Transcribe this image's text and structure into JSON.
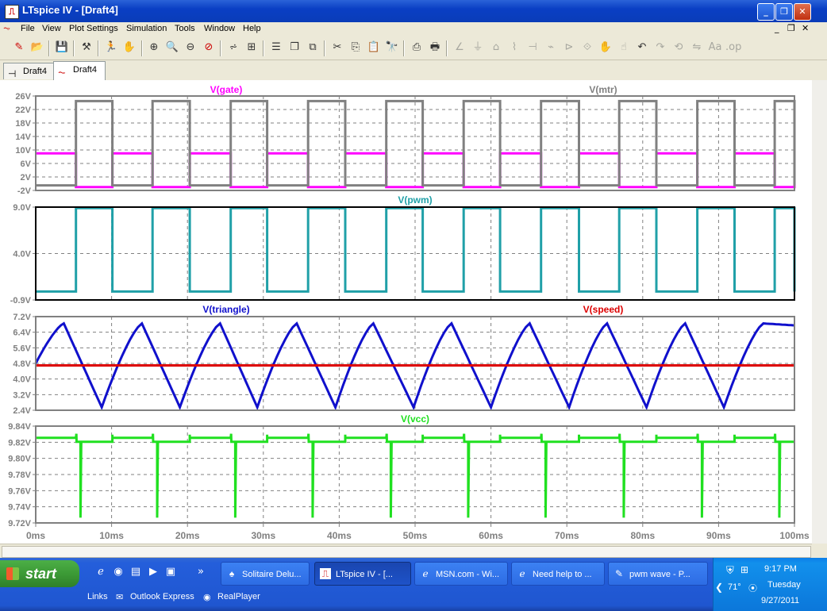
{
  "window": {
    "title": "LTspice IV - [Draft4]"
  },
  "menu": [
    "File",
    "View",
    "Plot Settings",
    "Simulation",
    "Tools",
    "Window",
    "Help"
  ],
  "tabs": [
    {
      "label": "Draft4",
      "icon": "schematic-icon"
    },
    {
      "label": "Draft4",
      "icon": "waveform-icon"
    }
  ],
  "chart_data": [
    {
      "type": "line",
      "series": [
        {
          "name": "V(gate)",
          "color": "#FF00FF",
          "high": 9,
          "low": -1,
          "low_intervals_ms": [
            [
              5.3,
              10.1
            ],
            [
              15.4,
              20.3
            ],
            [
              25.7,
              30.5
            ],
            [
              35.9,
              40.8
            ],
            [
              46.2,
              51.0
            ],
            [
              56.4,
              61.2
            ],
            [
              66.6,
              71.6
            ],
            [
              76.9,
              81.8
            ],
            [
              87.2,
              92.1
            ],
            [
              97.4,
              100
            ]
          ]
        },
        {
          "name": "V(mtr)",
          "color": "#808080",
          "high": 24.5,
          "low": -0.5,
          "high_intervals_ms": [
            [
              5.3,
              10.1
            ],
            [
              15.4,
              20.3
            ],
            [
              25.7,
              30.5
            ],
            [
              35.9,
              40.8
            ],
            [
              46.2,
              51.0
            ],
            [
              56.4,
              61.2
            ],
            [
              66.6,
              71.6
            ],
            [
              76.9,
              81.8
            ],
            [
              87.2,
              92.1
            ],
            [
              97.4,
              100
            ]
          ]
        }
      ],
      "yticks": [
        "26V",
        "22V",
        "18V",
        "14V",
        "10V",
        "6V",
        "2V",
        "-2V"
      ],
      "ylim": [
        -2,
        26
      ],
      "xlim": [
        0,
        100
      ]
    },
    {
      "type": "line",
      "series": [
        {
          "name": "V(pwm)",
          "color": "#20A0A8",
          "high": 8.9,
          "low": 0,
          "high_intervals_ms": [
            [
              5.3,
              10.1
            ],
            [
              15.4,
              20.3
            ],
            [
              25.7,
              30.5
            ],
            [
              35.9,
              40.8
            ],
            [
              46.2,
              51.0
            ],
            [
              56.4,
              61.2
            ],
            [
              66.6,
              71.6
            ],
            [
              76.9,
              81.8
            ],
            [
              87.2,
              92.1
            ],
            [
              97.4,
              100
            ]
          ]
        }
      ],
      "yticks": [
        "9.0V",
        "4.0V",
        "-0.9V"
      ],
      "ylim": [
        -0.9,
        9.0
      ],
      "xlim": [
        0,
        100
      ]
    },
    {
      "type": "line",
      "series": [
        {
          "name": "V(triangle)",
          "color": "#1010CC",
          "start": 4.8,
          "peaks_ms": [
            3.7,
            14.0,
            24.3,
            34.4,
            44.5,
            54.8,
            65.1,
            75.3,
            85.6,
            95.9
          ],
          "peak_value": 6.85,
          "troughs_ms": [
            8.7,
            19.0,
            29.2,
            39.5,
            49.8,
            60.0,
            70.3,
            80.5,
            90.7
          ],
          "trough_value": 2.55,
          "end": 6.75
        },
        {
          "name": "V(speed)",
          "color": "#DD0000",
          "value": 4.7
        }
      ],
      "yticks": [
        "7.2V",
        "6.4V",
        "5.6V",
        "4.8V",
        "4.0V",
        "3.2V",
        "2.4V"
      ],
      "ylim": [
        2.4,
        7.2
      ],
      "xlim": [
        0,
        100
      ]
    },
    {
      "type": "line",
      "series": [
        {
          "name": "V(vcc)",
          "color": "#20E020",
          "high": 9.8255,
          "low": 9.8205,
          "spike_bottom": 9.7265,
          "high_intervals_ms": [
            [
              0,
              5.3
            ],
            [
              10.1,
              15.4
            ],
            [
              20.3,
              25.7
            ],
            [
              30.5,
              35.9
            ],
            [
              40.8,
              46.2
            ],
            [
              51.0,
              56.4
            ],
            [
              61.2,
              66.6
            ],
            [
              71.6,
              76.9
            ],
            [
              81.8,
              87.2
            ],
            [
              92.1,
              97.4
            ]
          ]
        }
      ],
      "yticks": [
        "9.84V",
        "9.82V",
        "9.80V",
        "9.78V",
        "9.76V",
        "9.74V",
        "9.72V"
      ],
      "ylim": [
        9.72,
        9.84
      ],
      "xlim": [
        0,
        100
      ]
    }
  ],
  "x_axis": {
    "ticks": [
      "0ms",
      "10ms",
      "20ms",
      "30ms",
      "40ms",
      "50ms",
      "60ms",
      "70ms",
      "80ms",
      "90ms",
      "100ms"
    ],
    "range": [
      0,
      100
    ]
  },
  "taskbar": {
    "start": "start",
    "tasks": [
      "Solitaire Delu...",
      "LTspice IV - [...",
      "MSN.com - Wi...",
      "Need help to ...",
      "pwm wave - P..."
    ],
    "links_label": "Links",
    "links": [
      "Outlook Express",
      "RealPlayer"
    ],
    "clock": "9:17 PM",
    "day": "Tuesday",
    "date": "9/27/2011",
    "temp": "71°"
  }
}
